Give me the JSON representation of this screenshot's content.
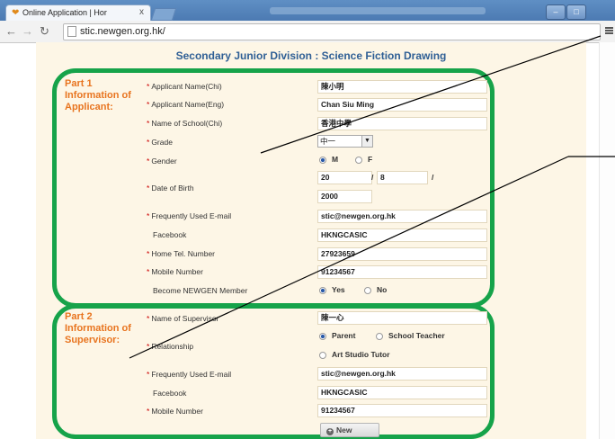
{
  "browser": {
    "tab_title": "Online Application | Hor",
    "tab_close": "x",
    "address": "stic.newgen.org.hk/",
    "back_icon": "back-arrow-icon",
    "forward_icon": "forward-arrow-icon",
    "reload_icon": "reload-icon"
  },
  "page": {
    "heading": "Secondary Junior Division : Science Fiction Drawing"
  },
  "part1": {
    "title": "Part 1 Information of Applicant:",
    "fields": {
      "name_chi": {
        "label": "Applicant Name(Chi)",
        "value": "陳小明"
      },
      "name_eng": {
        "label": "Applicant Name(Eng)",
        "value": "Chan Siu Ming"
      },
      "school_chi": {
        "label": "Name of School(Chi)",
        "value": "香港中學"
      },
      "grade": {
        "label": "Grade",
        "value": "中一"
      },
      "gender": {
        "label": "Gender",
        "option_m": "M",
        "option_f": "F",
        "selected": "M"
      },
      "dob": {
        "label": "Date of Birth",
        "day": "20",
        "sep1": "/",
        "month": "8",
        "sep2": "/",
        "year": "2000"
      },
      "email": {
        "label": "Frequently Used E-mail",
        "value": "stic@newgen.org.hk"
      },
      "facebook": {
        "label": "Facebook",
        "value": "HKNGCASIC"
      },
      "home_tel": {
        "label": "Home Tel. Number",
        "value": "27923659"
      },
      "mobile": {
        "label": "Mobile Number",
        "value": "91234567"
      },
      "member": {
        "label": "Become NEWGEN Member",
        "option_yes": "Yes",
        "option_no": "No",
        "selected": "Yes"
      }
    }
  },
  "part2": {
    "title": "Part 2 Information of Supervisor:",
    "fields": {
      "name": {
        "label": "Name of Supervisor",
        "value": "陳一心"
      },
      "relationship": {
        "label": "Relationship",
        "option_parent": "Parent",
        "option_teacher": "School Teacher",
        "option_tutor": "Art Studio Tutor",
        "selected": "Parent"
      },
      "email": {
        "label": "Frequently Used E-mail",
        "value": "stic@newgen.org.hk"
      },
      "facebook": {
        "label": "Facebook",
        "value": "HKNGCASIC"
      },
      "mobile": {
        "label": "Mobile Number",
        "value": "91234567"
      }
    },
    "new_button": "New"
  },
  "colors": {
    "highlight_frame": "#16a34a",
    "part_title": "#e8741f",
    "heading": "#2f5f95"
  }
}
